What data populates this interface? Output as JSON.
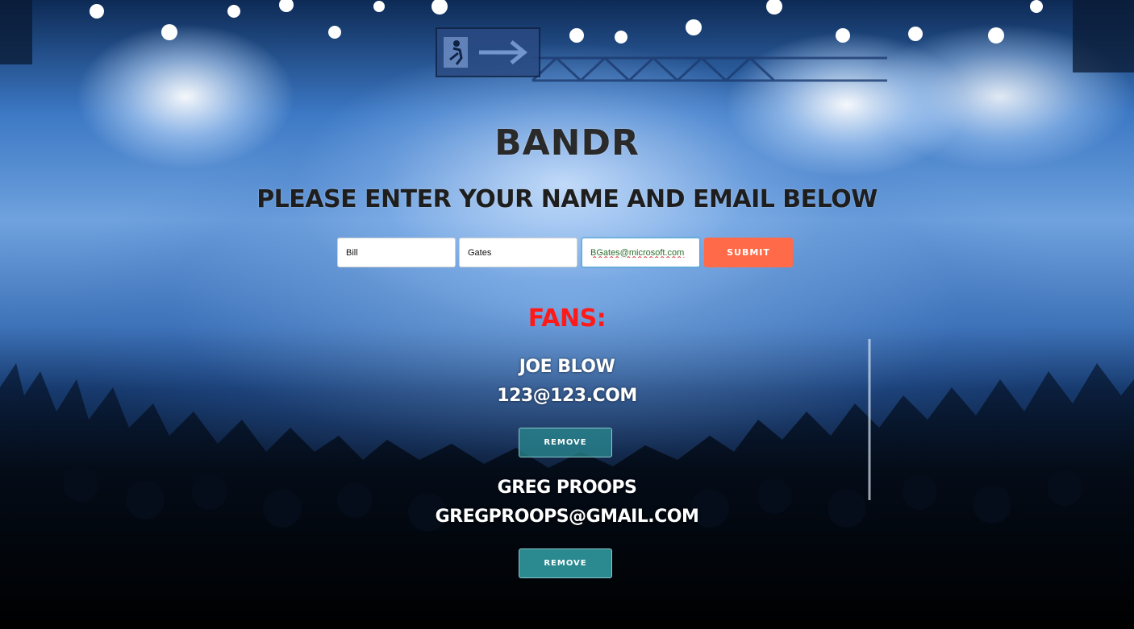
{
  "header": {
    "brand": "BANDR",
    "prompt": "PLEASE ENTER YOUR NAME AND EMAIL BELOW"
  },
  "form": {
    "first_name_value": "Bill",
    "last_name_value": "Gates",
    "email_value": "BGates@microsoft.com",
    "submit_label": "SUBMIT"
  },
  "fans": {
    "heading": "FANS:",
    "items": [
      {
        "name": "JOE BLOW",
        "email": "123@123.COM",
        "remove_label": "REMOVE"
      },
      {
        "name": "GREG PROOPS",
        "email": "GREGPROOPS@GMAIL.COM",
        "remove_label": "REMOVE"
      }
    ]
  },
  "colors": {
    "submit": "#ff6a48",
    "remove": "#2a8a90",
    "fans_heading": "#ff1a1a",
    "title_text": "#2a2a2a"
  },
  "icons": {
    "exit_sign": "emergency-exit-icon"
  }
}
